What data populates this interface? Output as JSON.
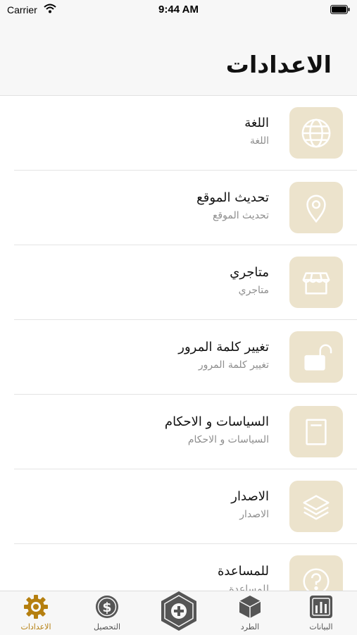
{
  "status_bar": {
    "carrier": "Carrier",
    "time": "9:44 AM"
  },
  "header": {
    "title": "الاعدادات"
  },
  "settings": {
    "items": [
      {
        "title": "اللغة",
        "subtitle": "اللغة",
        "icon": "globe-icon"
      },
      {
        "title": "تحديث الموقع",
        "subtitle": "تحديث الموقع",
        "icon": "location-pin-icon"
      },
      {
        "title": "متاجري",
        "subtitle": "متاجري",
        "icon": "store-icon"
      },
      {
        "title": "تغيير كلمة المرور",
        "subtitle": "تغيير كلمة المرور",
        "icon": "unlock-icon"
      },
      {
        "title": "السياسات و الاحكام",
        "subtitle": "السياسات و الاحكام",
        "icon": "document-icon"
      },
      {
        "title": "الاصدار",
        "subtitle": "الاصدار",
        "icon": "layers-icon"
      },
      {
        "title": "للمساعدة",
        "subtitle": "للمساعدة",
        "icon": "help-icon"
      }
    ]
  },
  "tab_bar": {
    "tabs": [
      {
        "label": "الاعدادات",
        "icon": "settings-gear-icon",
        "active": true
      },
      {
        "label": "التحصيل",
        "icon": "dollar-coin-icon",
        "active": false
      },
      {
        "label": "",
        "icon": "add-hexagon-icon",
        "active": false
      },
      {
        "label": "الطرد",
        "icon": "package-box-icon",
        "active": false
      },
      {
        "label": "البيانات",
        "icon": "bar-chart-icon",
        "active": false
      }
    ]
  },
  "colors": {
    "accent": "#b57f0f",
    "tile_background": "#ece3cc",
    "tile_icon": "#ffffff",
    "bar_background": "#f7f7f7"
  }
}
